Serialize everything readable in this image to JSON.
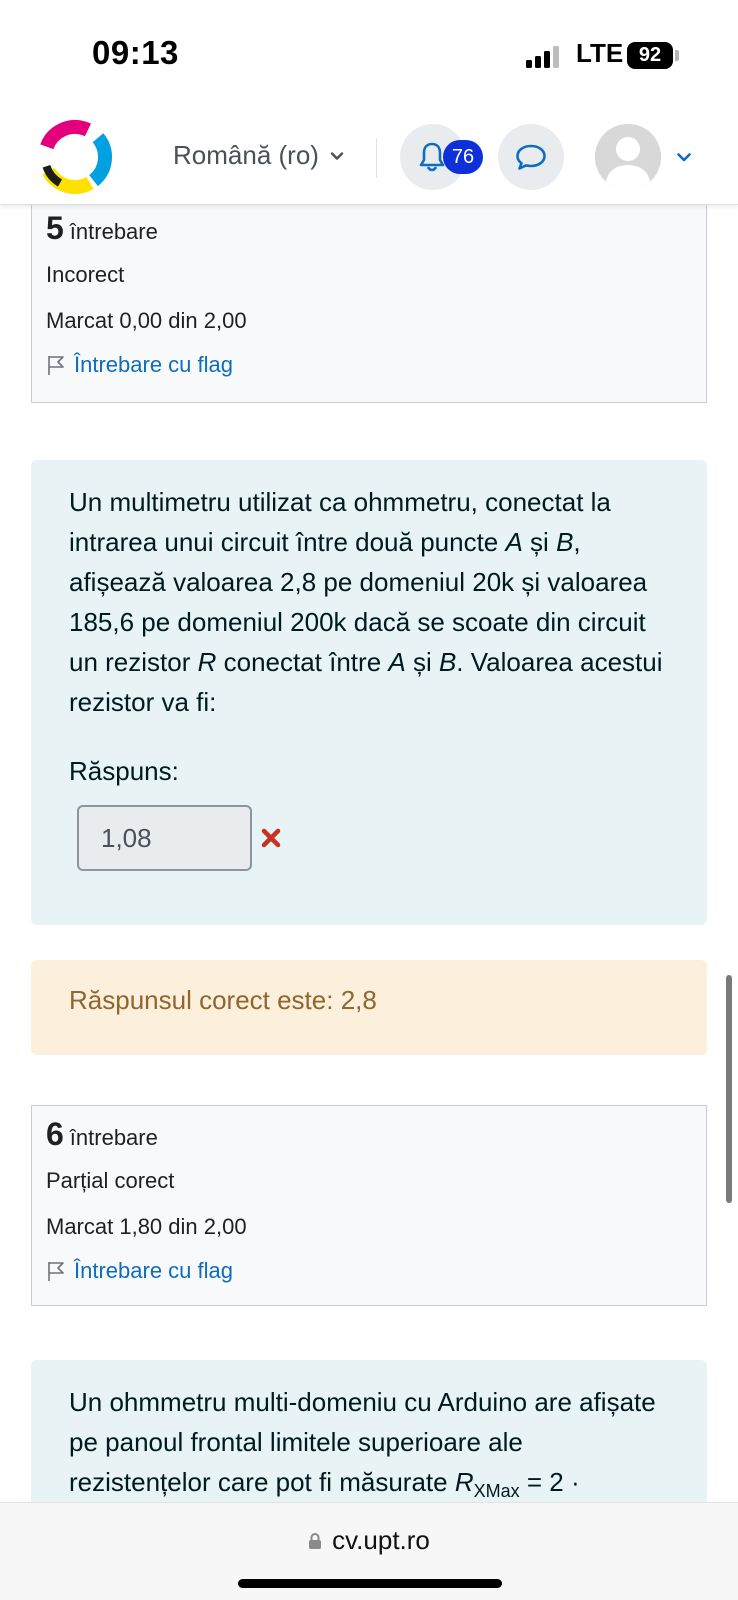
{
  "status_bar": {
    "time": "09:13",
    "network": "LTE",
    "battery": "92"
  },
  "navbar": {
    "language": "Română (ro)",
    "notifications_count": "76"
  },
  "questions": [
    {
      "number": "5",
      "label": "întrebare",
      "state": "Incorect",
      "grade": "Marcat 0,00 din 2,00",
      "flag_label": "Întrebare cu flag",
      "text": "Un multimetru utilizat ca ohmmetru, conectat la intrarea unui circuit între două puncte A și B, afișează valoarea 2,8 pe domeniul 20k și valoarea 185,6 pe domeniul 200k dacă se scoate din circuit un rezistor R conectat între A și B. Valoarea acestui rezistor va fi:",
      "answer_label": "Răspuns:",
      "answer_value": "1,08",
      "feedback": "Răspunsul corect este: 2,8"
    },
    {
      "number": "6",
      "label": "întrebare",
      "state": "Parțial corect",
      "grade": "Marcat 1,80 din 2,00",
      "flag_label": "Întrebare cu flag",
      "text_prefix": "Un ohmmetru multi-domeniu cu Arduino are afișate pe panoul frontal limitele superioare ale rezistențelor care pot fi măsurate ",
      "text_var": "R",
      "text_sub": "XMax",
      "text_suffix": " = 2 ·"
    }
  ],
  "browser": {
    "url": "cv.upt.ro"
  },
  "colors": {
    "link": "#0f6cbf",
    "badge": "#0f2fd8",
    "formulation_bg": "#e7f3f5",
    "feedback_bg": "#fcefdc",
    "wrong": "#ca3120"
  }
}
